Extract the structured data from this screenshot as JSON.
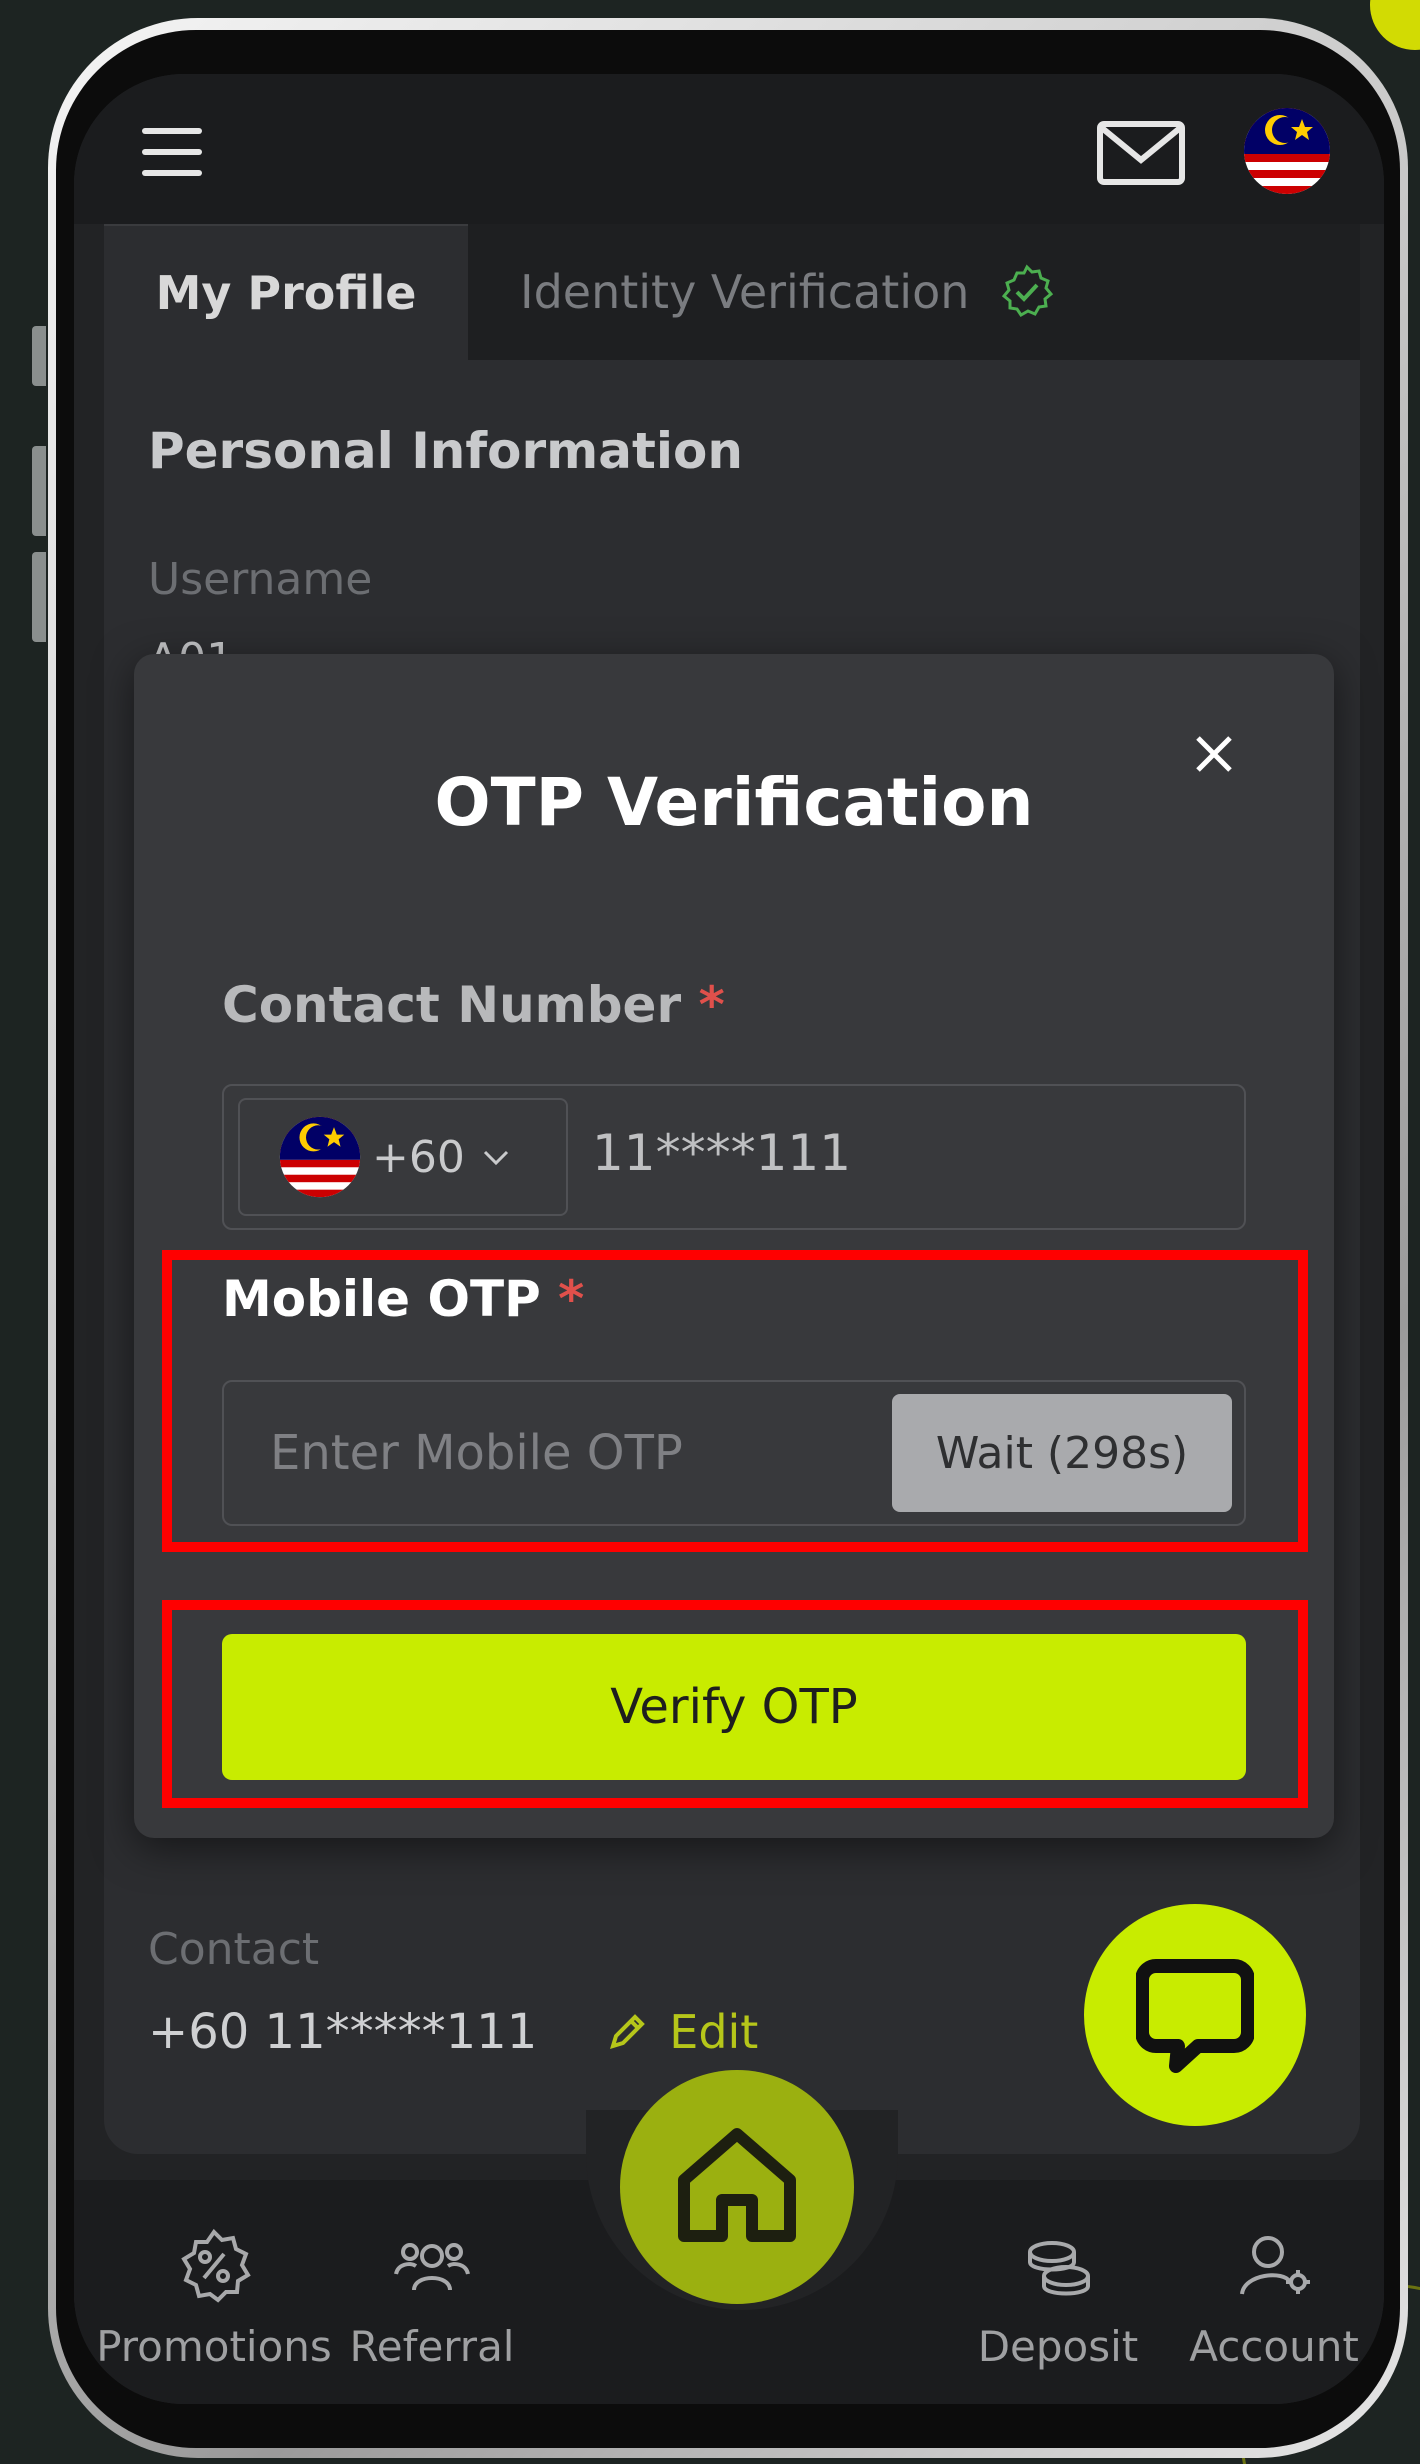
{
  "header": {
    "menu_icon": "hamburger-icon",
    "mail_icon": "mail-icon",
    "flag_icon": "malaysia-flag-icon"
  },
  "tabs": [
    {
      "label": "My Profile",
      "active": true
    },
    {
      "label": "Identity Verification",
      "active": false,
      "badge_icon": "verified-check-icon"
    }
  ],
  "profile": {
    "section_title": "Personal Information",
    "username_label": "Username",
    "username_value": "A01",
    "contact_label": "Contact",
    "contact_value": "+60 11*****111",
    "edit_label": "Edit"
  },
  "modal": {
    "title": "OTP Verification",
    "contact_label": "Contact Number",
    "required_mark": "*",
    "country_code": "+60",
    "phone_value": "11****111",
    "otp_label": "Mobile OTP",
    "otp_placeholder": "Enter Mobile OTP",
    "wait_label": "Wait (298s)",
    "verify_label": "Verify OTP"
  },
  "bottom_nav": [
    {
      "label": "Promotions",
      "icon": "promotion-badge-icon"
    },
    {
      "label": "Referral",
      "icon": "referral-people-icon"
    },
    {
      "label": "Deposit",
      "icon": "coins-icon"
    },
    {
      "label": "Account",
      "icon": "account-gear-icon"
    }
  ],
  "colors": {
    "accent": "#c8ec00",
    "highlight": "#ff0000",
    "background": "#222325",
    "required": "#e0504b"
  }
}
